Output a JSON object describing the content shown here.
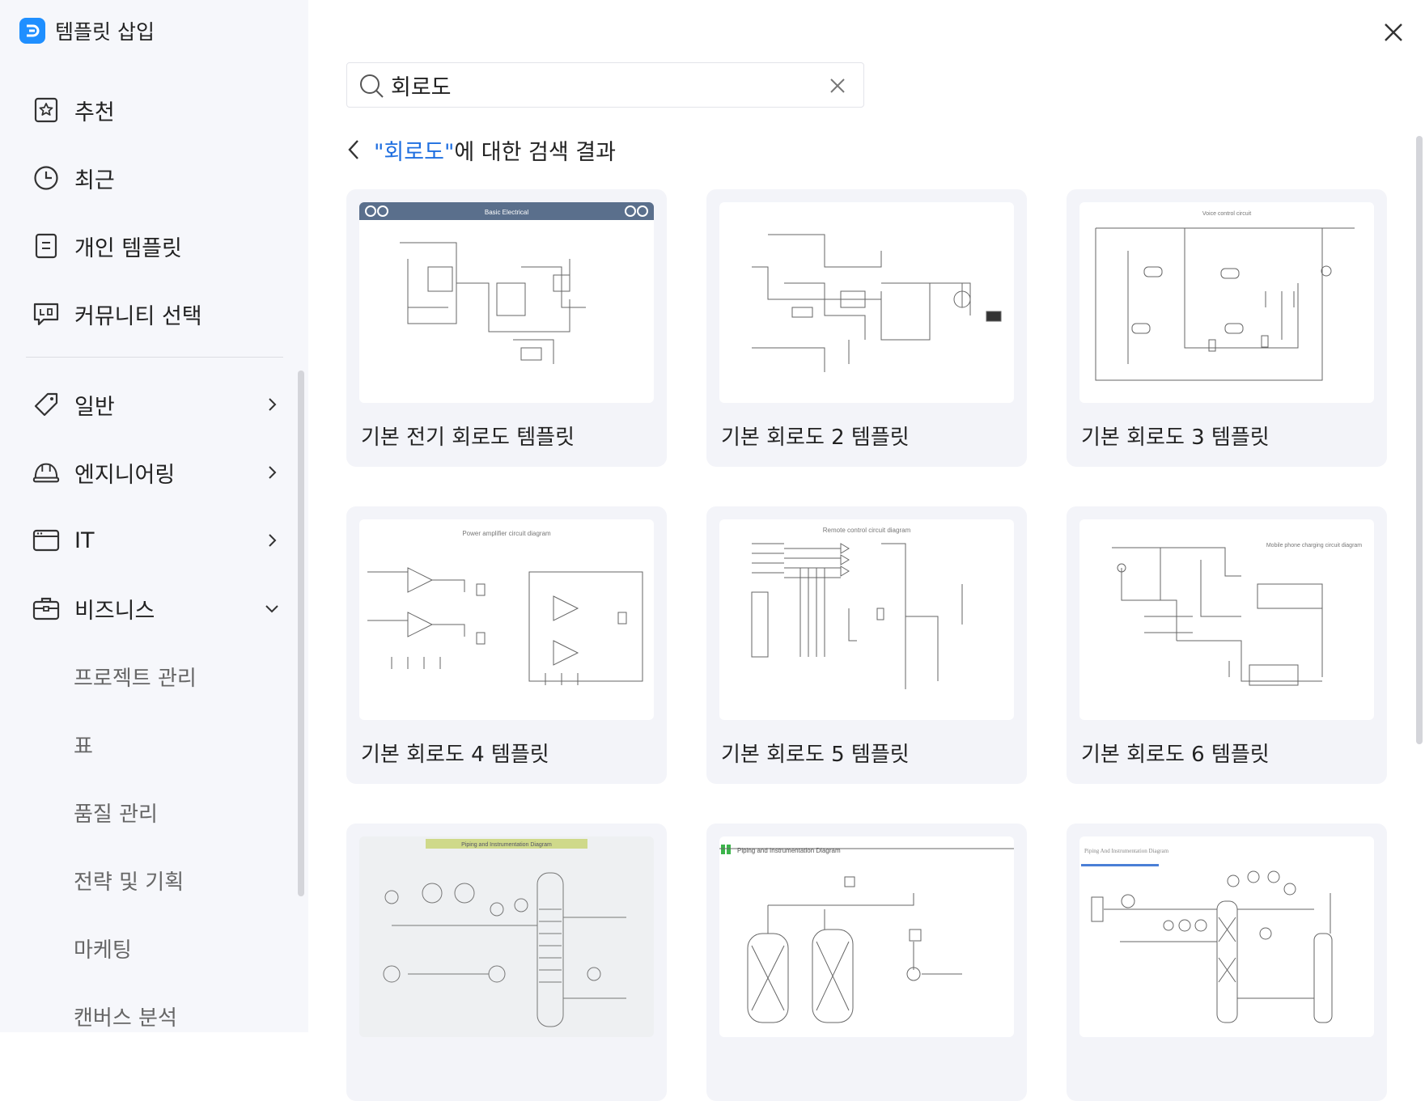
{
  "app": {
    "title": "템플릿 삽입"
  },
  "sidebar": {
    "main_items": [
      {
        "label": "추천",
        "icon": "star-document-icon"
      },
      {
        "label": "최근",
        "icon": "clock-icon"
      },
      {
        "label": "개인 템플릿",
        "icon": "document-icon"
      },
      {
        "label": "커뮤니티 선택",
        "icon": "chat-bubble-icon"
      }
    ],
    "categories": [
      {
        "label": "일반",
        "icon": "tag-icon",
        "expanded": false
      },
      {
        "label": "엔지니어링",
        "icon": "hard-hat-icon",
        "expanded": false
      },
      {
        "label": "IT",
        "icon": "browser-window-icon",
        "expanded": false
      },
      {
        "label": "비즈니스",
        "icon": "briefcase-icon",
        "expanded": true
      }
    ],
    "business_subitems": [
      "프로젝트 관리",
      "표",
      "품질 관리",
      "전략 및 기획",
      "마케팅",
      "캔버스 분석"
    ]
  },
  "search": {
    "value": "회로도"
  },
  "results": {
    "query_quoted": "\"회로도\"",
    "suffix": "에 대한 검색 결과",
    "cards": [
      {
        "title": "기본 전기 회로도 템플릿",
        "thumb_text": "Basic Electrical"
      },
      {
        "title": "기본 회로도 2 템플릿",
        "thumb_text": ""
      },
      {
        "title": "기본 회로도 3 템플릿",
        "thumb_text": "Voice control circuit"
      },
      {
        "title": "기본 회로도 4 템플릿",
        "thumb_text": "Power amplifier circuit diagram"
      },
      {
        "title": "기본 회로도 5 템플릿",
        "thumb_text": "Remote control circuit diagram"
      },
      {
        "title": "기본 회로도 6 템플릿",
        "thumb_text": "Mobile phone charging circuit diagram"
      },
      {
        "title": "",
        "thumb_text": "Piping and Instrumentation Diagram"
      },
      {
        "title": "",
        "thumb_text": "Piping and Instrumentation Diagram"
      },
      {
        "title": "",
        "thumb_text": "Piping And Instrumentation Diagram"
      }
    ]
  },
  "colors": {
    "accent": "#1f6fe0",
    "logo": "#1f8fff",
    "sidebar_bg": "#f6f7fb",
    "card_bg": "#f3f4f9"
  }
}
